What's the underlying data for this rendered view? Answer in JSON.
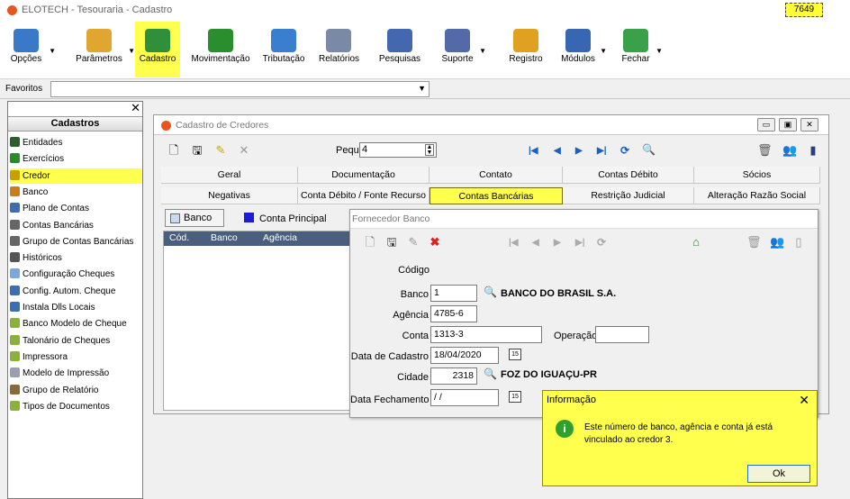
{
  "window": {
    "title": "ELOTECH - Tesouraria - Cadastro",
    "badge": "7649"
  },
  "toolbar": {
    "items": [
      {
        "label": "Opções",
        "icon": "options-icon",
        "color": "#3a78c8",
        "dropdown": true
      },
      {
        "label": "Parâmetros",
        "icon": "parameters-icon",
        "color": "#e0a630",
        "dropdown": true
      },
      {
        "label": "Cadastro",
        "icon": "register-icon",
        "color": "#2f8f3a",
        "dropdown": false,
        "active": true
      },
      {
        "label": "Movimentação",
        "icon": "movement-chart-icon",
        "color": "#2b8e2e",
        "dropdown": false
      },
      {
        "label": "Tributação",
        "icon": "taxation-chart-icon",
        "color": "#3a7ed0",
        "dropdown": false
      },
      {
        "label": "Relatórios",
        "icon": "printer-icon",
        "color": "#7a8aa6",
        "dropdown": false
      },
      {
        "label": "Pesquisas",
        "icon": "search-binoculars-icon",
        "color": "#4468b0",
        "dropdown": false
      },
      {
        "label": "Suporte",
        "icon": "support-person-icon",
        "color": "#546aa8",
        "dropdown": true
      },
      {
        "label": "Registro",
        "icon": "lock-icon",
        "color": "#e0a020",
        "dropdown": false
      },
      {
        "label": "Módulos",
        "icon": "monitor-icon",
        "color": "#3766b3",
        "dropdown": true
      },
      {
        "label": "Fechar",
        "icon": "exit-door-icon",
        "color": "#3aa04a",
        "dropdown": true
      }
    ]
  },
  "favorites": {
    "label": "Favoritos",
    "value": ""
  },
  "sidebar": {
    "title": "Cadastros",
    "items": [
      {
        "label": "Entidades",
        "icon": "building-icon",
        "color": "#2d5c2d"
      },
      {
        "label": "Exercícios",
        "icon": "flag-icon",
        "color": "#2a8a2a"
      },
      {
        "label": "Credor",
        "icon": "credor-icon",
        "color": "#c8a000",
        "active": true
      },
      {
        "label": "Banco",
        "icon": "bank-icon",
        "color": "#c87d1e"
      },
      {
        "label": "Plano de Contas",
        "icon": "accounts-plan-icon",
        "color": "#3b6fae"
      },
      {
        "label": "Contas Bancárias",
        "icon": "bank-accounts-icon",
        "color": "#666666"
      },
      {
        "label": "Grupo de Contas Bancárias",
        "icon": "bank-accounts-group-icon",
        "color": "#666666"
      },
      {
        "label": "Históricos",
        "icon": "history-icon",
        "color": "#555555"
      },
      {
        "label": "Configuração Cheques",
        "icon": "check-config-icon",
        "color": "#7da7d9"
      },
      {
        "label": "Config. Autom. Cheque",
        "icon": "check-auto-config-icon",
        "color": "#3a6fb0"
      },
      {
        "label": "Instala Dlls Locais",
        "icon": "install-dll-icon",
        "color": "#3a6fb0"
      },
      {
        "label": "Banco Modelo de Cheque",
        "icon": "check-model-icon",
        "color": "#8ab23a"
      },
      {
        "label": "Talonário de Cheques",
        "icon": "checkbook-icon",
        "color": "#8ab23a"
      },
      {
        "label": "Impressora",
        "icon": "printer-small-icon",
        "color": "#8ab23a"
      },
      {
        "label": "Modelo de Impressão",
        "icon": "print-model-icon",
        "color": "#9aa0b0"
      },
      {
        "label": "Grupo de Relatório",
        "icon": "report-group-icon",
        "color": "#8a6a3a"
      },
      {
        "label": "Tipos de Documentos",
        "icon": "document-types-icon",
        "color": "#8ab23a"
      }
    ]
  },
  "main": {
    "title": "Cadastro de Credores",
    "search_label": "Pequisa",
    "search_value": "4",
    "tabs_row1": [
      "Geral",
      "Documentação",
      "Contato",
      "Contas Débito",
      "Sócios"
    ],
    "tabs_row2": [
      "Negativas",
      "Conta Débito / Fonte Recurso",
      "Contas Bancárias",
      "Restrição Judicial",
      "Alteração Razão Social"
    ],
    "active_tab": "Contas Bancárias",
    "banco_button": "Banco",
    "legend_label": "Conta Principal",
    "legend_color": "#1c1cd8",
    "grid_columns": [
      "Cód.",
      "Banco",
      "Agência"
    ]
  },
  "dialog": {
    "title": "Fornecedor Banco",
    "fields": {
      "codigo_label": "Código",
      "banco_label": "Banco",
      "banco_value": "1",
      "banco_name": "BANCO DO BRASIL S.A.",
      "agencia_label": "Agência",
      "agencia_value": "4785-6",
      "conta_label": "Conta",
      "conta_value": "1313-3",
      "operacao_label": "Operação",
      "operacao_value": "",
      "data_cadastro_label": "Data de Cadastro",
      "data_cadastro_value": "18/04/2020",
      "cidade_label": "Cidade",
      "cidade_value": "2318",
      "cidade_name": "FOZ DO IGUAÇU-PR",
      "data_fechamento_label": "Data Fechamento",
      "data_fechamento_value": " /  /"
    }
  },
  "info": {
    "title": "Informação",
    "message": "Este número de banco, agência e conta já está vinculado ao credor 3.",
    "ok_label": "Ok",
    "highlight_color": "#ffff4d"
  }
}
